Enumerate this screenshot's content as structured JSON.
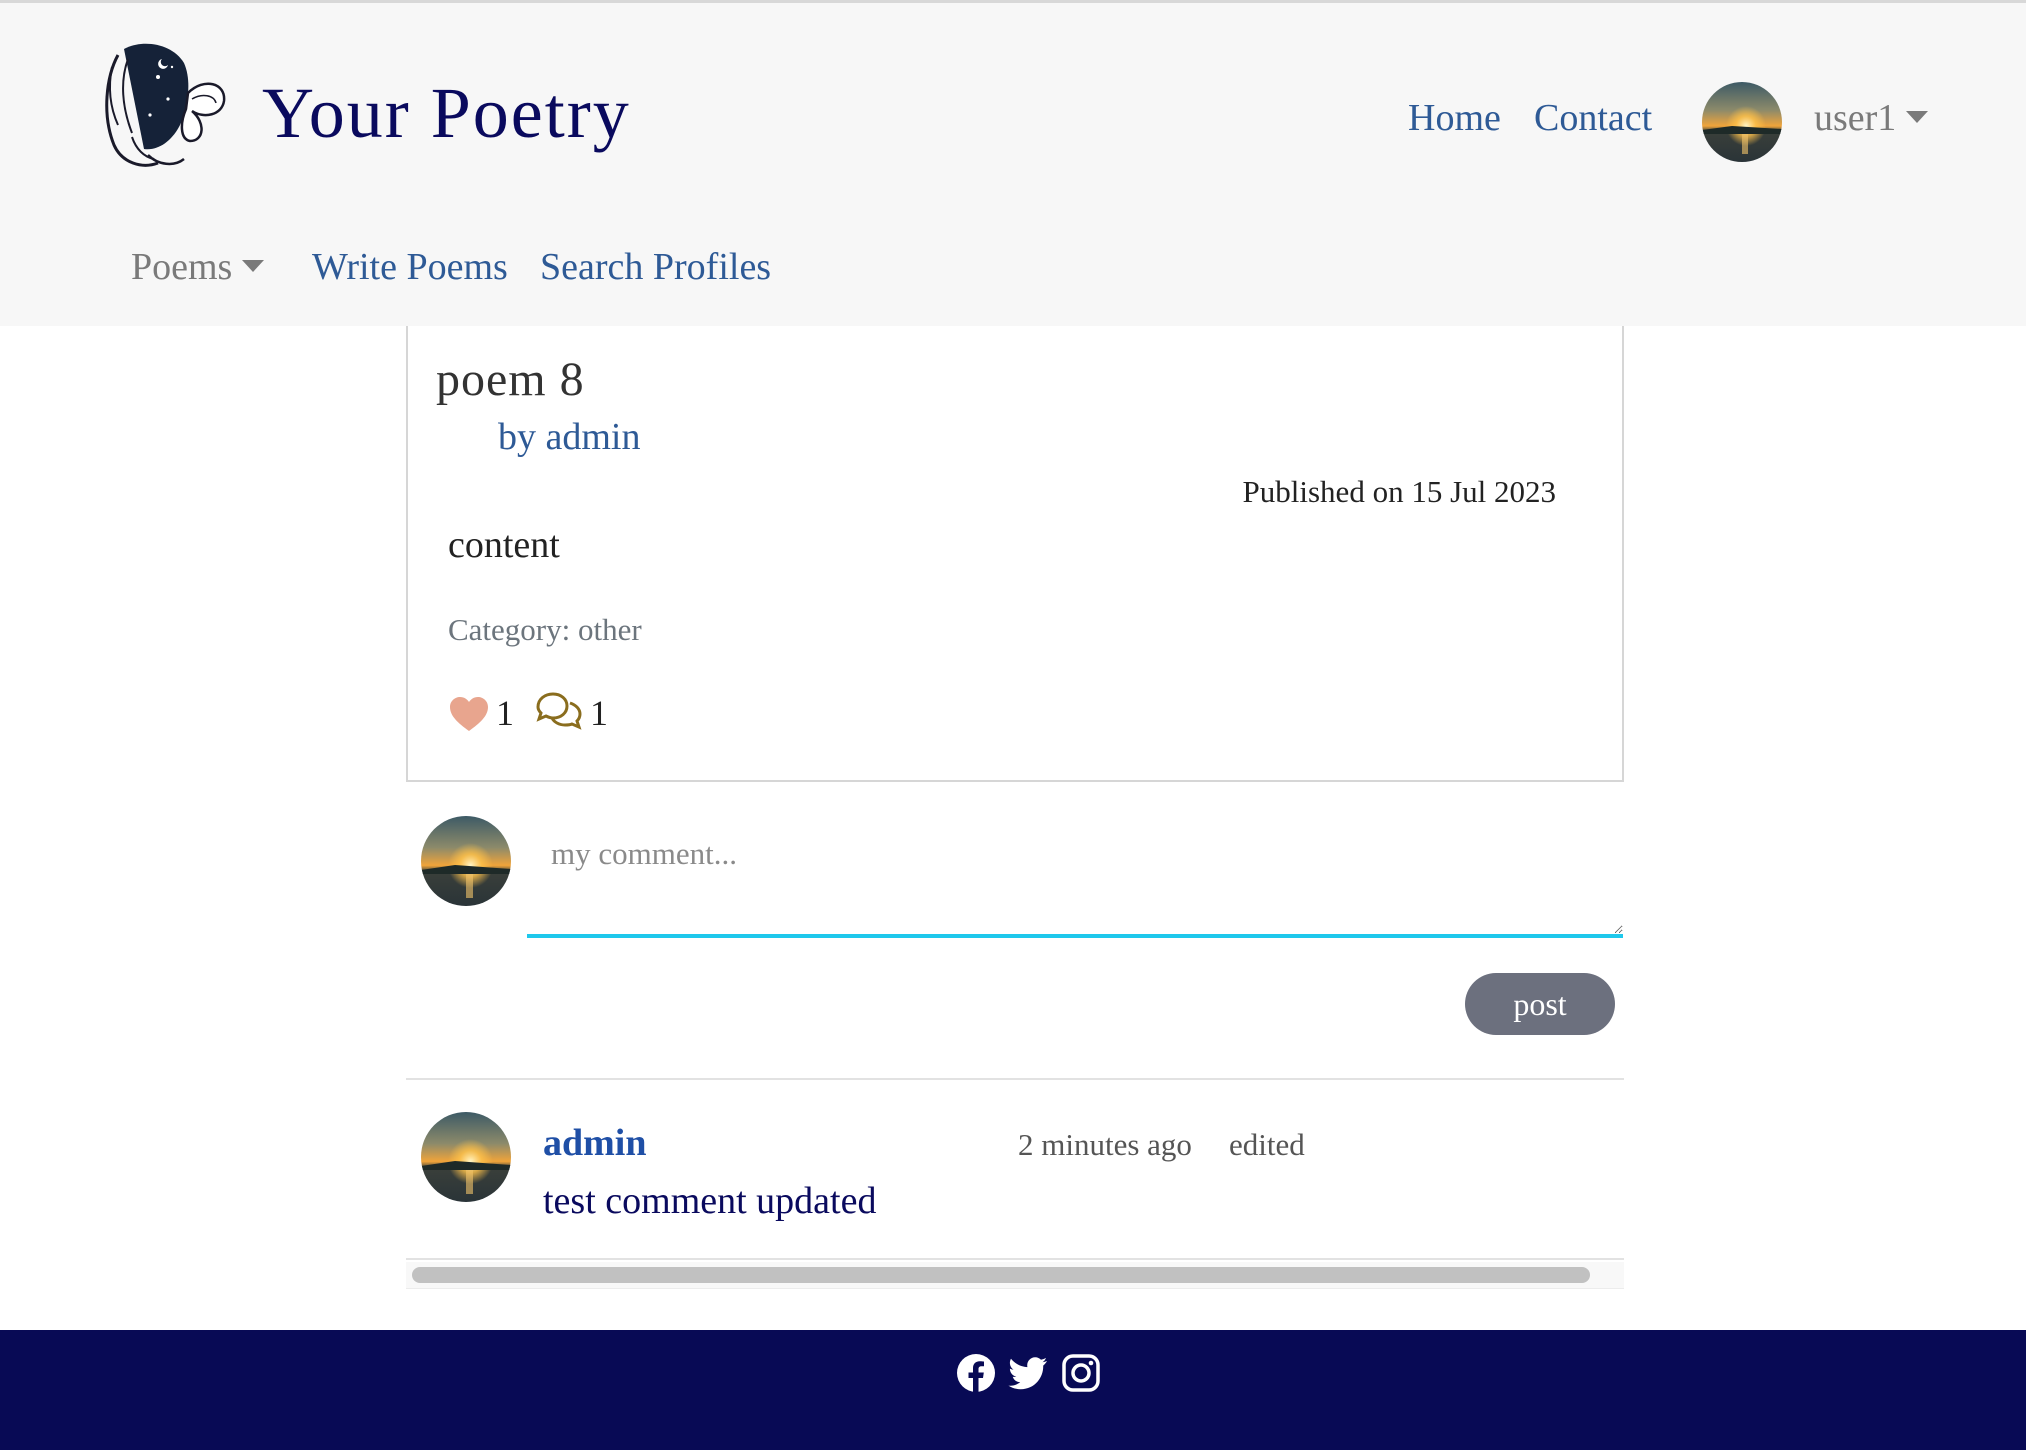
{
  "brand": {
    "title": "Your Poetry",
    "logo_icon": "woman-butterfly-logo-icon"
  },
  "nav": {
    "home": "Home",
    "contact": "Contact",
    "user": "user1",
    "poems": "Poems",
    "write_poems": "Write Poems",
    "search_profiles": "Search Profiles"
  },
  "poem": {
    "title": "poem 8",
    "author": "by admin",
    "published": "Published on 15 Jul 2023",
    "content": "content",
    "category": "Category: other",
    "likes": "1",
    "comments": "1"
  },
  "comment_form": {
    "placeholder": "my comment...",
    "post_label": "post"
  },
  "comments": [
    {
      "author": "admin",
      "time": "2 minutes ago",
      "edited": "edited",
      "text": "test comment updated"
    }
  ],
  "footer": {
    "icons": [
      "facebook-icon",
      "twitter-icon",
      "instagram-icon"
    ]
  },
  "colors": {
    "brand": "#0a0a5e",
    "link": "#2e5a96",
    "footer_bg": "#080a55",
    "like": "#e8a58e",
    "comment_icon": "#8a6d1e",
    "input_focus": "#1ec8ec",
    "post_button": "#6c707e"
  }
}
